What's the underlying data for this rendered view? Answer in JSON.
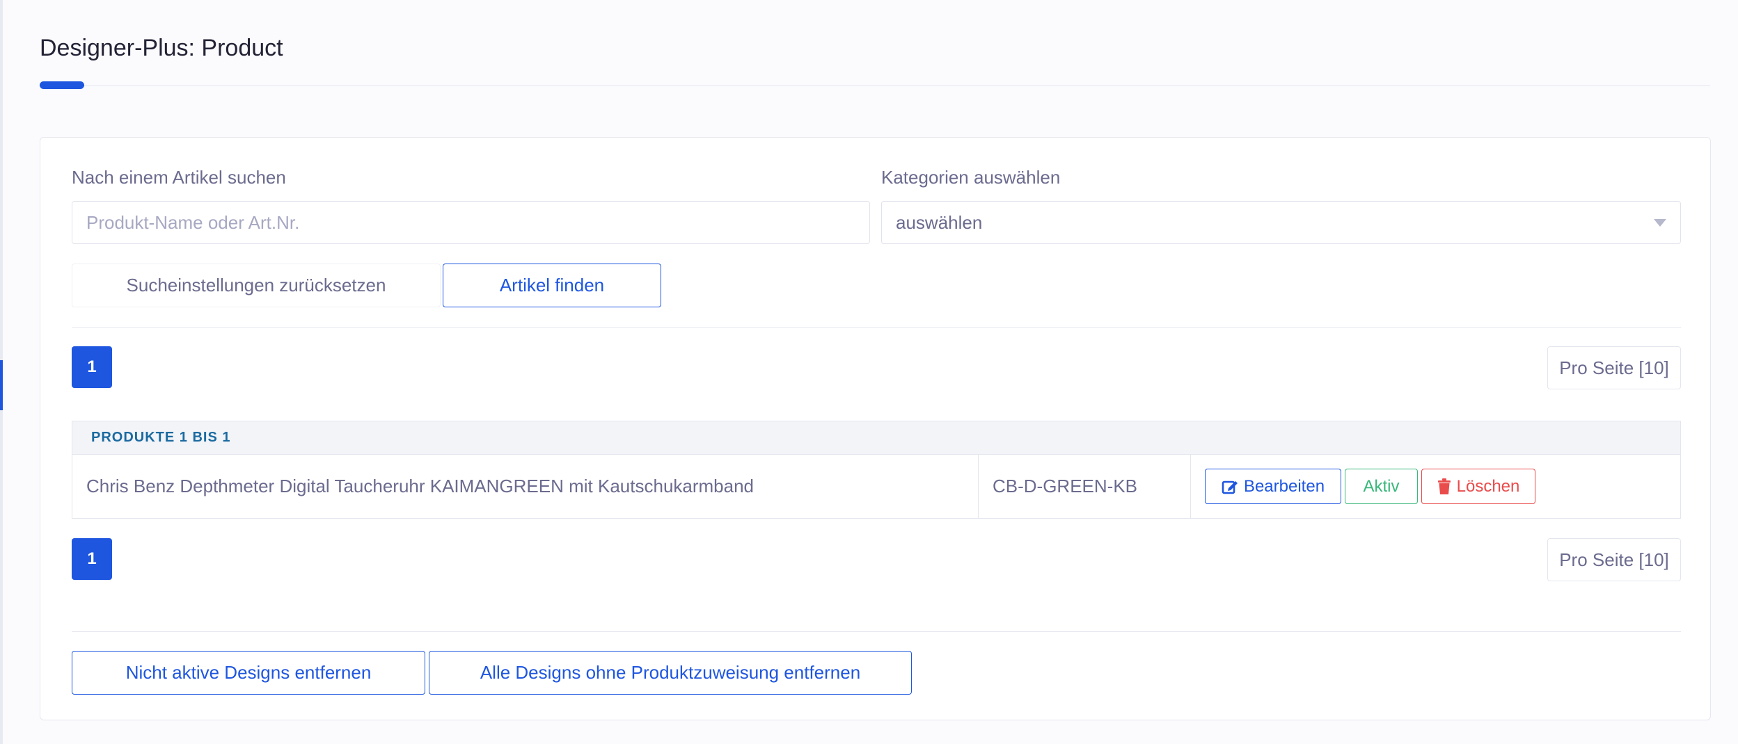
{
  "page": {
    "title": "Designer-Plus: Product"
  },
  "search": {
    "label": "Nach einem Artikel suchen",
    "placeholder": "Produkt-Name oder Art.Nr.",
    "value": ""
  },
  "category": {
    "label": "Kategorien auswählen",
    "selected": "auswählen"
  },
  "actions": {
    "reset_label": "Sucheinstellungen zurücksetzen",
    "find_label": "Artikel finden"
  },
  "pagination": {
    "current_page": "1",
    "per_page_label": "Pro Seite [10]"
  },
  "table": {
    "header": "PRODUKTE 1 BIS 1",
    "rows": [
      {
        "name": "Chris Benz Depthmeter Digital Taucheruhr KAIMANGREEN mit Kautschukarmband",
        "sku": "CB-D-GREEN-KB",
        "edit_label": "Bearbeiten",
        "status_label": "Aktiv",
        "delete_label": "Löschen"
      }
    ]
  },
  "footer_actions": {
    "remove_inactive_label": "Nicht aktive Designs entfernen",
    "remove_unassigned_label": "Alle Designs ohne Produktzuweisung entfernen"
  },
  "colors": {
    "primary": "#1e56e0",
    "success": "#39b77a",
    "danger": "#ea4b4b",
    "text": "#6b6b8f"
  }
}
